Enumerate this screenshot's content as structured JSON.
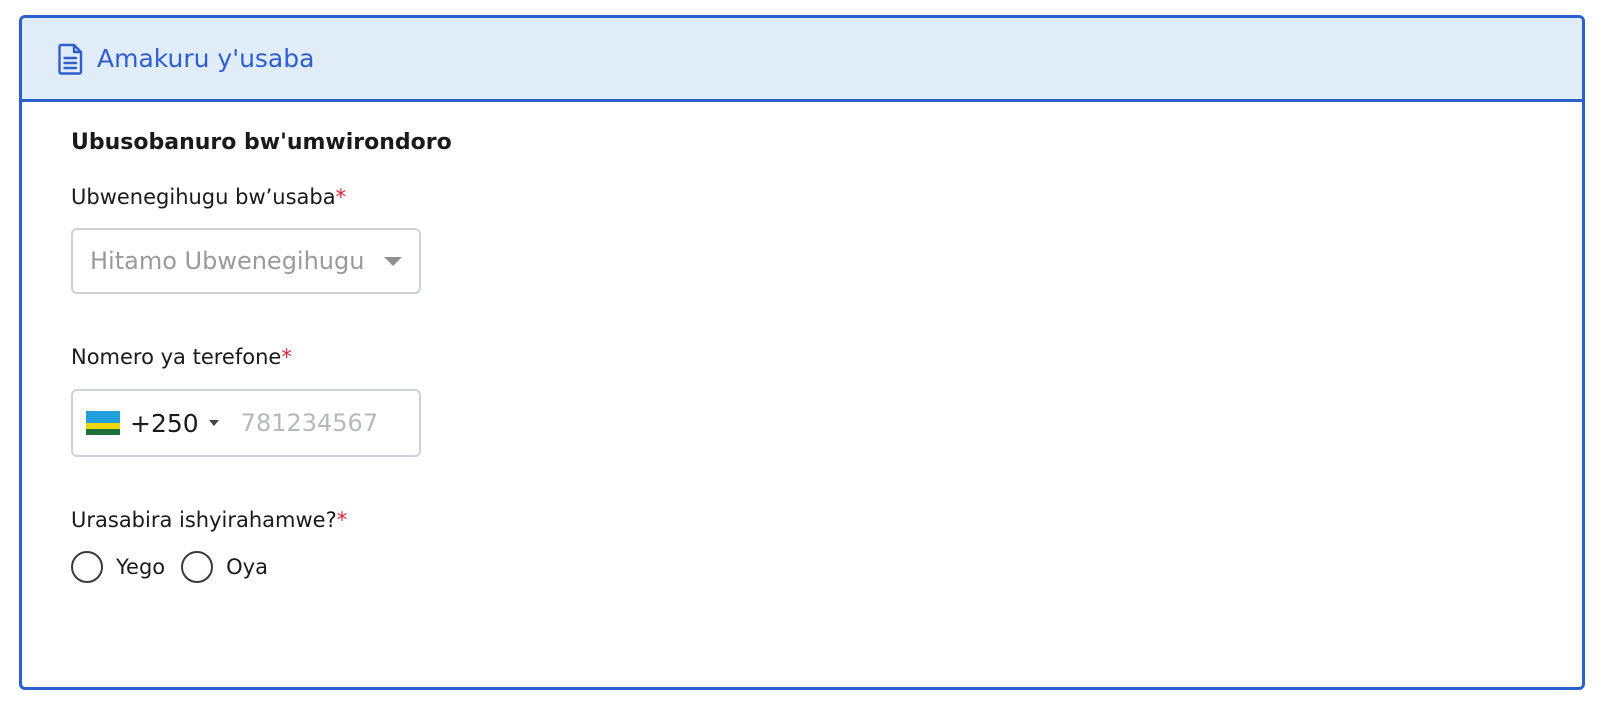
{
  "header": {
    "title": "Amakuru y'usaba",
    "icon": "document-icon"
  },
  "section": {
    "title": "Ubusobanuro bw'umwirondoro"
  },
  "nationality": {
    "label": "Ubwenegihugu bw’usaba",
    "required_mark": "*",
    "placeholder": "Hitamo Ubwenegihugu"
  },
  "phone": {
    "label": "Nomero ya terefone",
    "required_mark": "*",
    "country_code": "+250",
    "placeholder": "781234567",
    "value": ""
  },
  "group_question": {
    "label": "Urasabira ishyirahamwe?",
    "required_mark": "*",
    "options": [
      {
        "label": "Yego"
      },
      {
        "label": "Oya"
      }
    ]
  },
  "colors": {
    "accent": "#2e5fd1",
    "header_bg": "#e1ecf9",
    "required": "#e0243a"
  }
}
